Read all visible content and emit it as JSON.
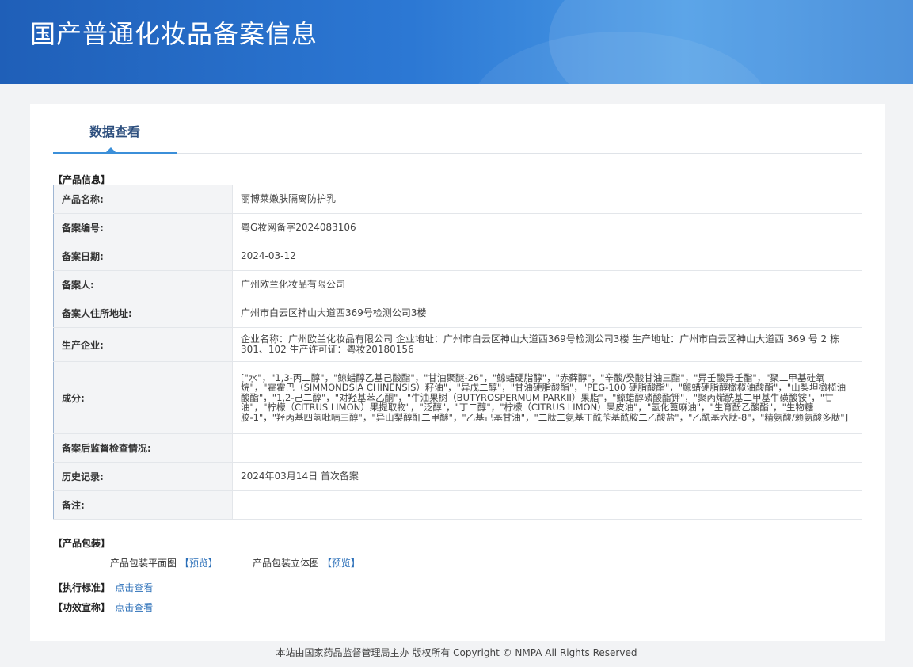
{
  "header": {
    "title": "国产普通化妆品备案信息"
  },
  "tabs": {
    "active_label": "数据查看"
  },
  "product_info": {
    "section_title": "【产品信息】",
    "rows": [
      {
        "label": "产品名称:",
        "value": "丽博莱嫩肤隔离防护乳"
      },
      {
        "label": "备案编号:",
        "value": "粤G妆网备字2024083106"
      },
      {
        "label": "备案日期:",
        "value": "2024-03-12"
      },
      {
        "label": "备案人:",
        "value": "广州欧兰化妆品有限公司"
      },
      {
        "label": "备案人住所地址:",
        "value": "广州市白云区神山大道西369号检测公司3楼"
      },
      {
        "label": "生产企业:",
        "value": "企业名称：广州欧兰化妆品有限公司 企业地址：广州市白云区神山大道西369号检测公司3楼 生产地址：广州市白云区神山大道西 369 号 2 栋 301、102 生产许可证：粤妆20180156"
      },
      {
        "label": "成分:",
        "value": "[\"水\"，\"1,3-丙二醇\"，\"鲸蜡醇乙基己酸酯\"，\"甘油聚醚-26\"，\"鲸蜡硬脂醇\"，\"赤藓醇\"，\"辛酸/癸酸甘油三酯\"，\"异壬酸异壬酯\"，\"聚二甲基硅氧烷\"，\"霍霍巴（SIMMONDSIA CHINENSIS）籽油\"，\"异戊二醇\"，\"甘油硬脂酸酯\"，\"PEG-100 硬脂酸酯\"，\"鲸蜡硬脂醇橄榄油酸酯\"，\"山梨坦橄榄油酸酯\"，\"1,2-己二醇\"，\"对羟基苯乙酮\"，\"牛油果树（BUTYROSPERMUM PARKII）果脂\"，\"鲸蜡醇磷酸酯钾\"，\"聚丙烯酰基二甲基牛磺酸铵\"，\"甘油\"，\"柠檬（CITRUS LIMON）果提取物\"，\"泛醇\"，\"丁二醇\"，\"柠檬（CITRUS LIMON）果皮油\"，\"氢化蓖麻油\"，\"生育酚乙酸酯\"，\"生物糖 胶-1\"，\"羟丙基四氢吡喃三醇\"，\"异山梨醇酐二甲醚\"，\"乙基己基甘油\"，\"二肽二氨基丁酰苄基酰胺二乙酸盐\"，\"乙酰基六肽-8\"，\"精氨酸/赖氨酸多肽\"]"
      },
      {
        "label": "备案后监督检查情况:",
        "value": ""
      },
      {
        "label": "历史记录:",
        "value": "2024年03月14日 首次备案"
      },
      {
        "label": "备注:",
        "value": ""
      }
    ]
  },
  "packaging": {
    "section_title": "【产品包装】",
    "flat_label": "产品包装平面图",
    "flat_link": "【预览】",
    "three_d_label": "产品包装立体图",
    "three_d_link": "【预览】"
  },
  "standard": {
    "section_title": "【执行标准】",
    "link": "点击查看"
  },
  "efficacy": {
    "section_title": "【功效宣称】",
    "link": "点击查看"
  },
  "footer": {
    "text": "本站由国家药品监督管理局主办 版权所有 Copyright © NMPA All Rights Reserved"
  }
}
